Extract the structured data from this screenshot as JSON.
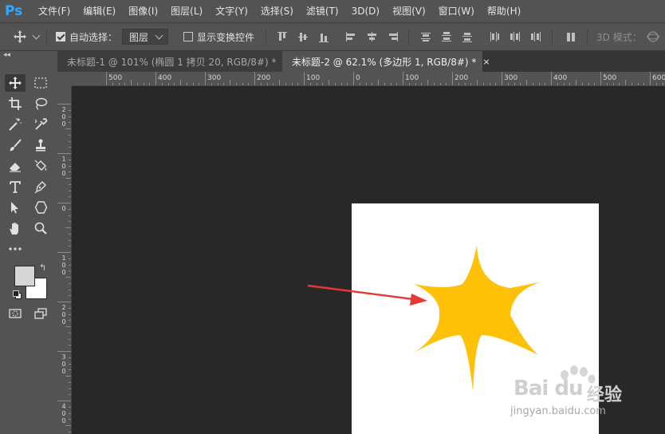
{
  "app": {
    "logo": "Ps"
  },
  "menu": [
    "文件(F)",
    "编辑(E)",
    "图像(I)",
    "图层(L)",
    "文字(Y)",
    "选择(S)",
    "滤镜(T)",
    "3D(D)",
    "视图(V)",
    "窗口(W)",
    "帮助(H)"
  ],
  "options": {
    "auto_select_label": "自动选择：",
    "auto_select_checked": true,
    "layer_select_value": "图层",
    "show_transform_label": "显示变换控件",
    "show_transform_checked": false,
    "mode_3d_label": "3D 模式："
  },
  "tabs": [
    {
      "label": "未标题-1 @ 101% (椭圆 1 拷贝 20, RGB/8#) *",
      "close": "×",
      "active": false
    },
    {
      "label": "未标题-2 @ 62.1% (多边形 1, RGB/8#) *",
      "close": "×",
      "active": true
    }
  ],
  "ruler_h": [
    "500",
    "400",
    "300",
    "200",
    "100",
    "0",
    "100",
    "200",
    "300",
    "400",
    "500",
    "600"
  ],
  "ruler_v": [
    [
      "2",
      "0",
      "0"
    ],
    [
      "1",
      "0",
      "0"
    ],
    [
      "0"
    ],
    [
      "1",
      "0",
      "0"
    ],
    [
      "2",
      "0",
      "0"
    ],
    [
      "3",
      "0",
      "0"
    ],
    [
      "4",
      "0",
      "0"
    ]
  ],
  "colors": {
    "foreground": "#d6d6d6",
    "background": "#ffffff",
    "shape_fill": "#ffc107",
    "arrow": "#e53935"
  },
  "watermark": {
    "brand": "Bai du",
    "suffix": "经验",
    "url": "jingyan.baidu.com"
  }
}
